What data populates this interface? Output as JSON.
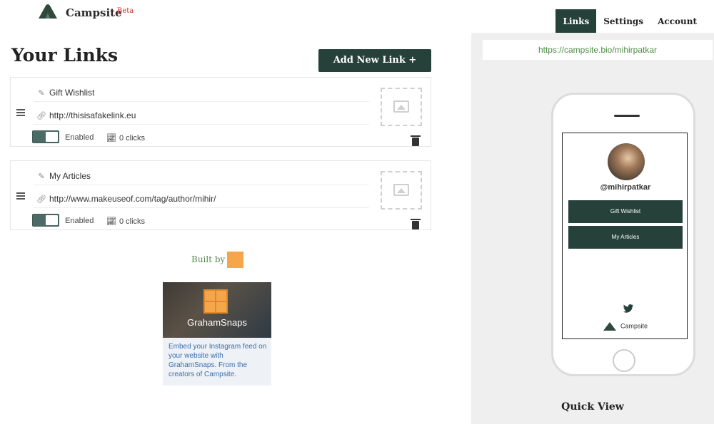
{
  "header": {
    "brand": "Campsite",
    "badge": "Beta",
    "nav": [
      {
        "label": "Links",
        "active": true
      },
      {
        "label": "Settings",
        "active": false
      },
      {
        "label": "Account",
        "active": false
      }
    ]
  },
  "main": {
    "title": "Your Links",
    "add_button": "Add New Link +",
    "links": [
      {
        "title": "Gift Wishlist",
        "url": "http://thisisafakelink.eu",
        "status": "Enabled",
        "clicks": "0 clicks"
      },
      {
        "title": "My Articles",
        "url": "http://www.makeuseof.com/tag/author/mihir/",
        "status": "Enabled",
        "clicks": "0 clicks"
      }
    ],
    "built_by": "Built by",
    "promo": {
      "name": "GrahamSnaps",
      "text": "Embed your Instagram feed on your website with GrahamSnaps. From the creators of Campsite."
    }
  },
  "preview": {
    "url": "https://campsite.bio/mihirpatkar",
    "username": "@mihirpatkar",
    "buttons": [
      "Gift Wishlist",
      "My Articles"
    ],
    "footer": "Campsite",
    "caption": "Quick View"
  },
  "colors": {
    "primary": "#26403a",
    "accent": "#f5a64a",
    "badge": "#c0392b",
    "url_green": "#4e8e46"
  }
}
